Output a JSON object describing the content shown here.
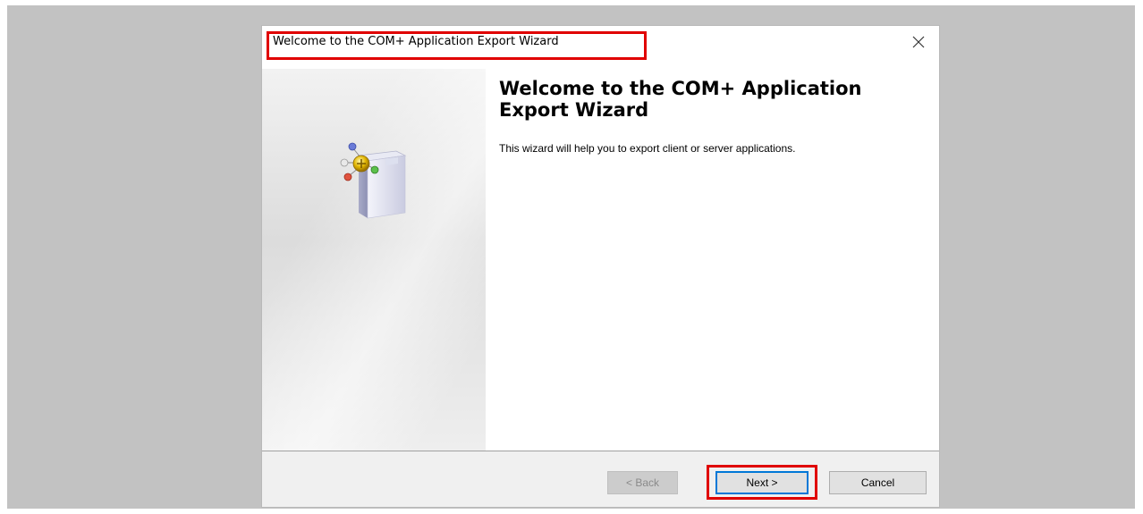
{
  "dialog": {
    "title": "Welcome to the COM+ Application Export Wizard",
    "close_glyph": "✕",
    "heading": "Welcome to the COM+ Application Export Wizard",
    "description": "This wizard will help you to export client or server applications."
  },
  "buttons": {
    "back": "< Back",
    "next": "Next >",
    "cancel": "Cancel"
  },
  "icons": {
    "sidebar": "com-plus-package-icon",
    "close": "close-icon"
  },
  "colors": {
    "highlight": "#e00000",
    "focus": "#0078d7",
    "backdrop": "#c2c2c2"
  }
}
